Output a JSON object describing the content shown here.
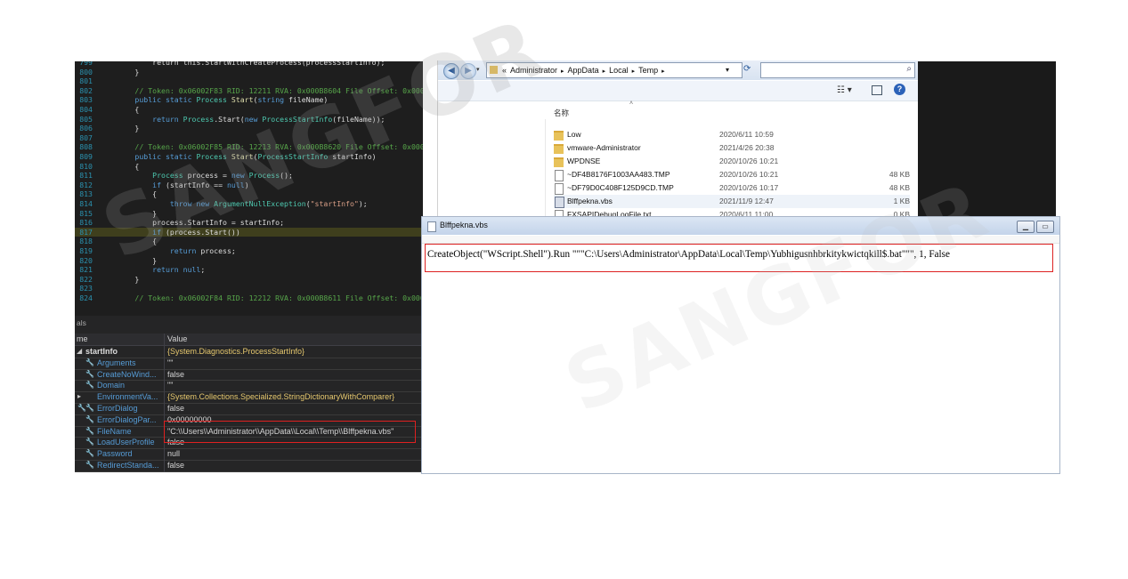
{
  "code": {
    "lines": [
      {
        "num": "799",
        "tokens": [
          {
            "t": "            return this.StartWithCreateProcess(processStartInfo);",
            "c": "pl"
          }
        ]
      },
      {
        "num": "800",
        "tokens": [
          {
            "t": "        }",
            "c": "pl"
          }
        ]
      },
      {
        "num": "801",
        "tokens": [
          {
            "t": "",
            "c": "pl"
          }
        ]
      },
      {
        "num": "802",
        "tokens": [
          {
            "t": "        // Token: 0x06002F83 RID: 12211 RVA: 0x000B8604 File Offset: 0x000B6",
            "c": "cm"
          }
        ]
      },
      {
        "num": "803",
        "tokens": [
          {
            "t": "        public static ",
            "c": "kw"
          },
          {
            "t": "Process",
            "c": "ty"
          },
          {
            "t": " Start",
            "c": "mt"
          },
          {
            "t": "(",
            "c": "pl"
          },
          {
            "t": "string",
            "c": "kw"
          },
          {
            "t": " fileName)",
            "c": "pl"
          }
        ]
      },
      {
        "num": "804",
        "tokens": [
          {
            "t": "        {",
            "c": "pl"
          }
        ]
      },
      {
        "num": "805",
        "tokens": [
          {
            "t": "            return ",
            "c": "kw"
          },
          {
            "t": "Process",
            "c": "ty"
          },
          {
            "t": ".Start(",
            "c": "pl"
          },
          {
            "t": "new ",
            "c": "kw"
          },
          {
            "t": "ProcessStartInfo",
            "c": "ty"
          },
          {
            "t": "(fileName));",
            "c": "pl"
          }
        ]
      },
      {
        "num": "806",
        "tokens": [
          {
            "t": "        }",
            "c": "pl"
          }
        ]
      },
      {
        "num": "807",
        "tokens": [
          {
            "t": "",
            "c": "pl"
          }
        ]
      },
      {
        "num": "808",
        "tokens": [
          {
            "t": "        // Token: 0x06002F85 RID: 12213 RVA: 0x000B8620 File Offset: 0x000B6",
            "c": "cm"
          }
        ]
      },
      {
        "num": "809",
        "tokens": [
          {
            "t": "        public static ",
            "c": "kw"
          },
          {
            "t": "Process",
            "c": "ty"
          },
          {
            "t": " Start",
            "c": "mt"
          },
          {
            "t": "(",
            "c": "pl"
          },
          {
            "t": "ProcessStartInfo",
            "c": "ty"
          },
          {
            "t": " startInfo)",
            "c": "pl"
          }
        ]
      },
      {
        "num": "810",
        "tokens": [
          {
            "t": "        {",
            "c": "pl"
          }
        ]
      },
      {
        "num": "811",
        "tokens": [
          {
            "t": "            Process",
            "c": "ty"
          },
          {
            "t": " process = ",
            "c": "pl"
          },
          {
            "t": "new ",
            "c": "kw"
          },
          {
            "t": "Process",
            "c": "ty"
          },
          {
            "t": "();",
            "c": "pl"
          }
        ]
      },
      {
        "num": "812",
        "tokens": [
          {
            "t": "            if ",
            "c": "kw"
          },
          {
            "t": "(startInfo == ",
            "c": "pl"
          },
          {
            "t": "null",
            "c": "kw"
          },
          {
            "t": ")",
            "c": "pl"
          }
        ]
      },
      {
        "num": "813",
        "tokens": [
          {
            "t": "            {",
            "c": "pl"
          }
        ]
      },
      {
        "num": "814",
        "tokens": [
          {
            "t": "                throw new ",
            "c": "kw"
          },
          {
            "t": "ArgumentNullException",
            "c": "ty"
          },
          {
            "t": "(",
            "c": "pl"
          },
          {
            "t": "\"startInfo\"",
            "c": "st"
          },
          {
            "t": ");",
            "c": "pl"
          }
        ]
      },
      {
        "num": "815",
        "tokens": [
          {
            "t": "            }",
            "c": "pl"
          }
        ]
      },
      {
        "num": "816",
        "tokens": [
          {
            "t": "            process.StartInfo = startInfo;",
            "c": "pl"
          }
        ]
      },
      {
        "num": "817",
        "hl": true,
        "tokens": [
          {
            "t": "            if ",
            "c": "kw"
          },
          {
            "t": "(process.Start())",
            "c": "pl"
          }
        ]
      },
      {
        "num": "818",
        "tokens": [
          {
            "t": "            {",
            "c": "pl"
          }
        ]
      },
      {
        "num": "819",
        "tokens": [
          {
            "t": "                return ",
            "c": "kw"
          },
          {
            "t": "process;",
            "c": "pl"
          }
        ]
      },
      {
        "num": "820",
        "tokens": [
          {
            "t": "            }",
            "c": "pl"
          }
        ]
      },
      {
        "num": "821",
        "tokens": [
          {
            "t": "            return ",
            "c": "kw"
          },
          {
            "t": "null",
            "c": "kw"
          },
          {
            "t": ";",
            "c": "pl"
          }
        ]
      },
      {
        "num": "822",
        "tokens": [
          {
            "t": "        }",
            "c": "pl"
          }
        ]
      },
      {
        "num": "823",
        "tokens": [
          {
            "t": "",
            "c": "pl"
          }
        ]
      },
      {
        "num": "824",
        "tokens": [
          {
            "t": "        // Token: 0x06002F84 RID: 12212 RVA: 0x000B8611 File Offset: 0x000",
            "c": "cm"
          }
        ]
      }
    ]
  },
  "locals": {
    "tab_label": "als",
    "col_name": "me",
    "col_value": "Value",
    "rows": [
      {
        "name": "startInfo",
        "value": "{System.Diagnostics.ProcessStartInfo}",
        "root": true
      },
      {
        "name": "Arguments",
        "value": "\"\""
      },
      {
        "name": "CreateNoWind...",
        "value": "false"
      },
      {
        "name": "Domain",
        "value": "\"\""
      },
      {
        "name": "EnvironmentVa...",
        "value": "{System.Collections.Specialized.StringDictionaryWithComparer}",
        "expand": true
      },
      {
        "name": "ErrorDialog",
        "value": "false"
      },
      {
        "name": "ErrorDialogPar...",
        "value": "0x00000000"
      },
      {
        "name": "FileName",
        "value": "\"C:\\\\Users\\\\Administrator\\\\AppData\\\\Local\\\\Temp\\\\Blffpekna.vbs\""
      },
      {
        "name": "LoadUserProfile",
        "value": "false"
      },
      {
        "name": "Password",
        "value": "null"
      },
      {
        "name": "RedirectStanda...",
        "value": "false"
      }
    ]
  },
  "explorer": {
    "breadcrumb": [
      "«",
      "Administrator",
      "AppData",
      "Local",
      "Temp"
    ],
    "column_name": "名称",
    "files": [
      {
        "name": "Low",
        "date": "2020/6/11 10:59",
        "size": "",
        "type": "folder"
      },
      {
        "name": "vmware-Administrator",
        "date": "2021/4/26 20:38",
        "size": "",
        "type": "folder"
      },
      {
        "name": "WPDNSE",
        "date": "2020/10/26 10:21",
        "size": "",
        "type": "folder"
      },
      {
        "name": "~DF4B8176F1003AA483.TMP",
        "date": "2020/10/26 10:21",
        "size": "48 KB",
        "type": "file"
      },
      {
        "name": "~DF79D0C408F125D9CD.TMP",
        "date": "2020/10/26 10:17",
        "size": "48 KB",
        "type": "file"
      },
      {
        "name": "Blffpekna.vbs",
        "date": "2021/11/9 12:47",
        "size": "1 KB",
        "type": "vbs",
        "selected": true
      },
      {
        "name": "FXSAPIDebugLogFile.txt",
        "date": "2020/6/11 11:00",
        "size": "0 KB",
        "type": "file"
      }
    ]
  },
  "notepad": {
    "title": "Blffpekna.vbs",
    "content": "CreateObject(\"WScript.Shell\").Run \"\"\"C:\\Users\\Administrator\\AppData\\Local\\Temp\\Yubhigusnhbrkitykwictqkill$.bat\"\"\", 1, False"
  },
  "watermark": "SANGFOR"
}
